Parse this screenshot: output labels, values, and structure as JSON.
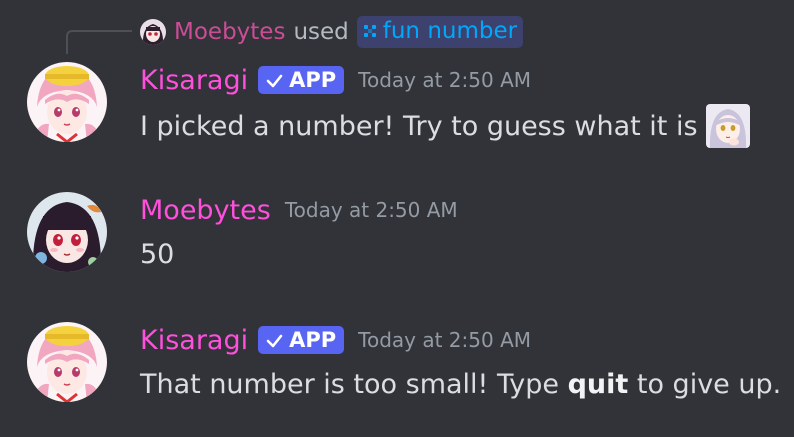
{
  "reply": {
    "user": "Moebytes",
    "used": "used",
    "command": "fun number",
    "command_icon": "slash-command-icon"
  },
  "messages": [
    {
      "username": "Kisaragi",
      "badge": "APP",
      "badge_icon": "check-icon",
      "timestamp": "Today at 2:50 AM",
      "text": "I picked a number! Try to guess what it is",
      "emoji": "thinking-anime-girl-emoji",
      "avatar_icon": "kisaragi-avatar"
    },
    {
      "username": "Moebytes",
      "timestamp": "Today at 2:50 AM",
      "text": "50",
      "avatar_icon": "moebytes-avatar"
    },
    {
      "username": "Kisaragi",
      "badge": "APP",
      "badge_icon": "check-icon",
      "timestamp": "Today at 2:50 AM",
      "text_before": "That number is too small! Type ",
      "text_bold": "quit",
      "text_after": " to give up.",
      "avatar_icon": "kisaragi-avatar"
    }
  ],
  "colors": {
    "background": "#313338",
    "username": "#ff4fdc",
    "reply_user": "#ca4d95",
    "app_badge": "#5865f2",
    "timestamp": "#949ba4",
    "command_chip_bg": "#3c416d",
    "command_chip_text": "#00a8fc"
  }
}
